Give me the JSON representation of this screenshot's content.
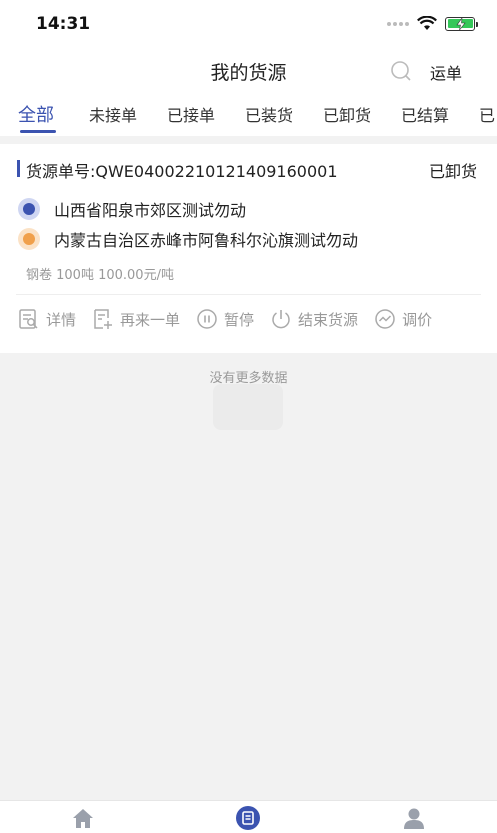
{
  "status_bar": {
    "time": "14:31"
  },
  "nav": {
    "title": "我的货源",
    "waybill_label": "运单"
  },
  "tabs": [
    {
      "label": "全部",
      "active": true
    },
    {
      "label": "未接单"
    },
    {
      "label": "已接单"
    },
    {
      "label": "已装货"
    },
    {
      "label": "已卸货"
    },
    {
      "label": "已结算"
    },
    {
      "label": "已"
    }
  ],
  "colors": {
    "accent": "#3b53b0",
    "origin_dot": "#3b53b0",
    "dest_dot": "#f0a04b"
  },
  "card": {
    "order_label": "货源单号:QWE04002210121409160001",
    "status": "已卸货",
    "origin": "山西省阳泉市郊区测试勿动",
    "destination": "内蒙古自治区赤峰市阿鲁科尔沁旗测试勿动",
    "cargo": "钢卷  100吨  100.00元/吨",
    "actions": [
      {
        "label": "详情",
        "icon": "details-icon"
      },
      {
        "label": "再来一单",
        "icon": "reorder-icon"
      },
      {
        "label": "暂停",
        "icon": "pause-icon"
      },
      {
        "label": "结束货源",
        "icon": "power-icon"
      },
      {
        "label": "调价",
        "icon": "price-trend-icon"
      }
    ]
  },
  "footer": {
    "no_more": "没有更多数据"
  },
  "bottom_tabs": [
    {
      "icon": "home-icon"
    },
    {
      "icon": "list-icon",
      "active": true
    },
    {
      "icon": "user-icon"
    }
  ]
}
